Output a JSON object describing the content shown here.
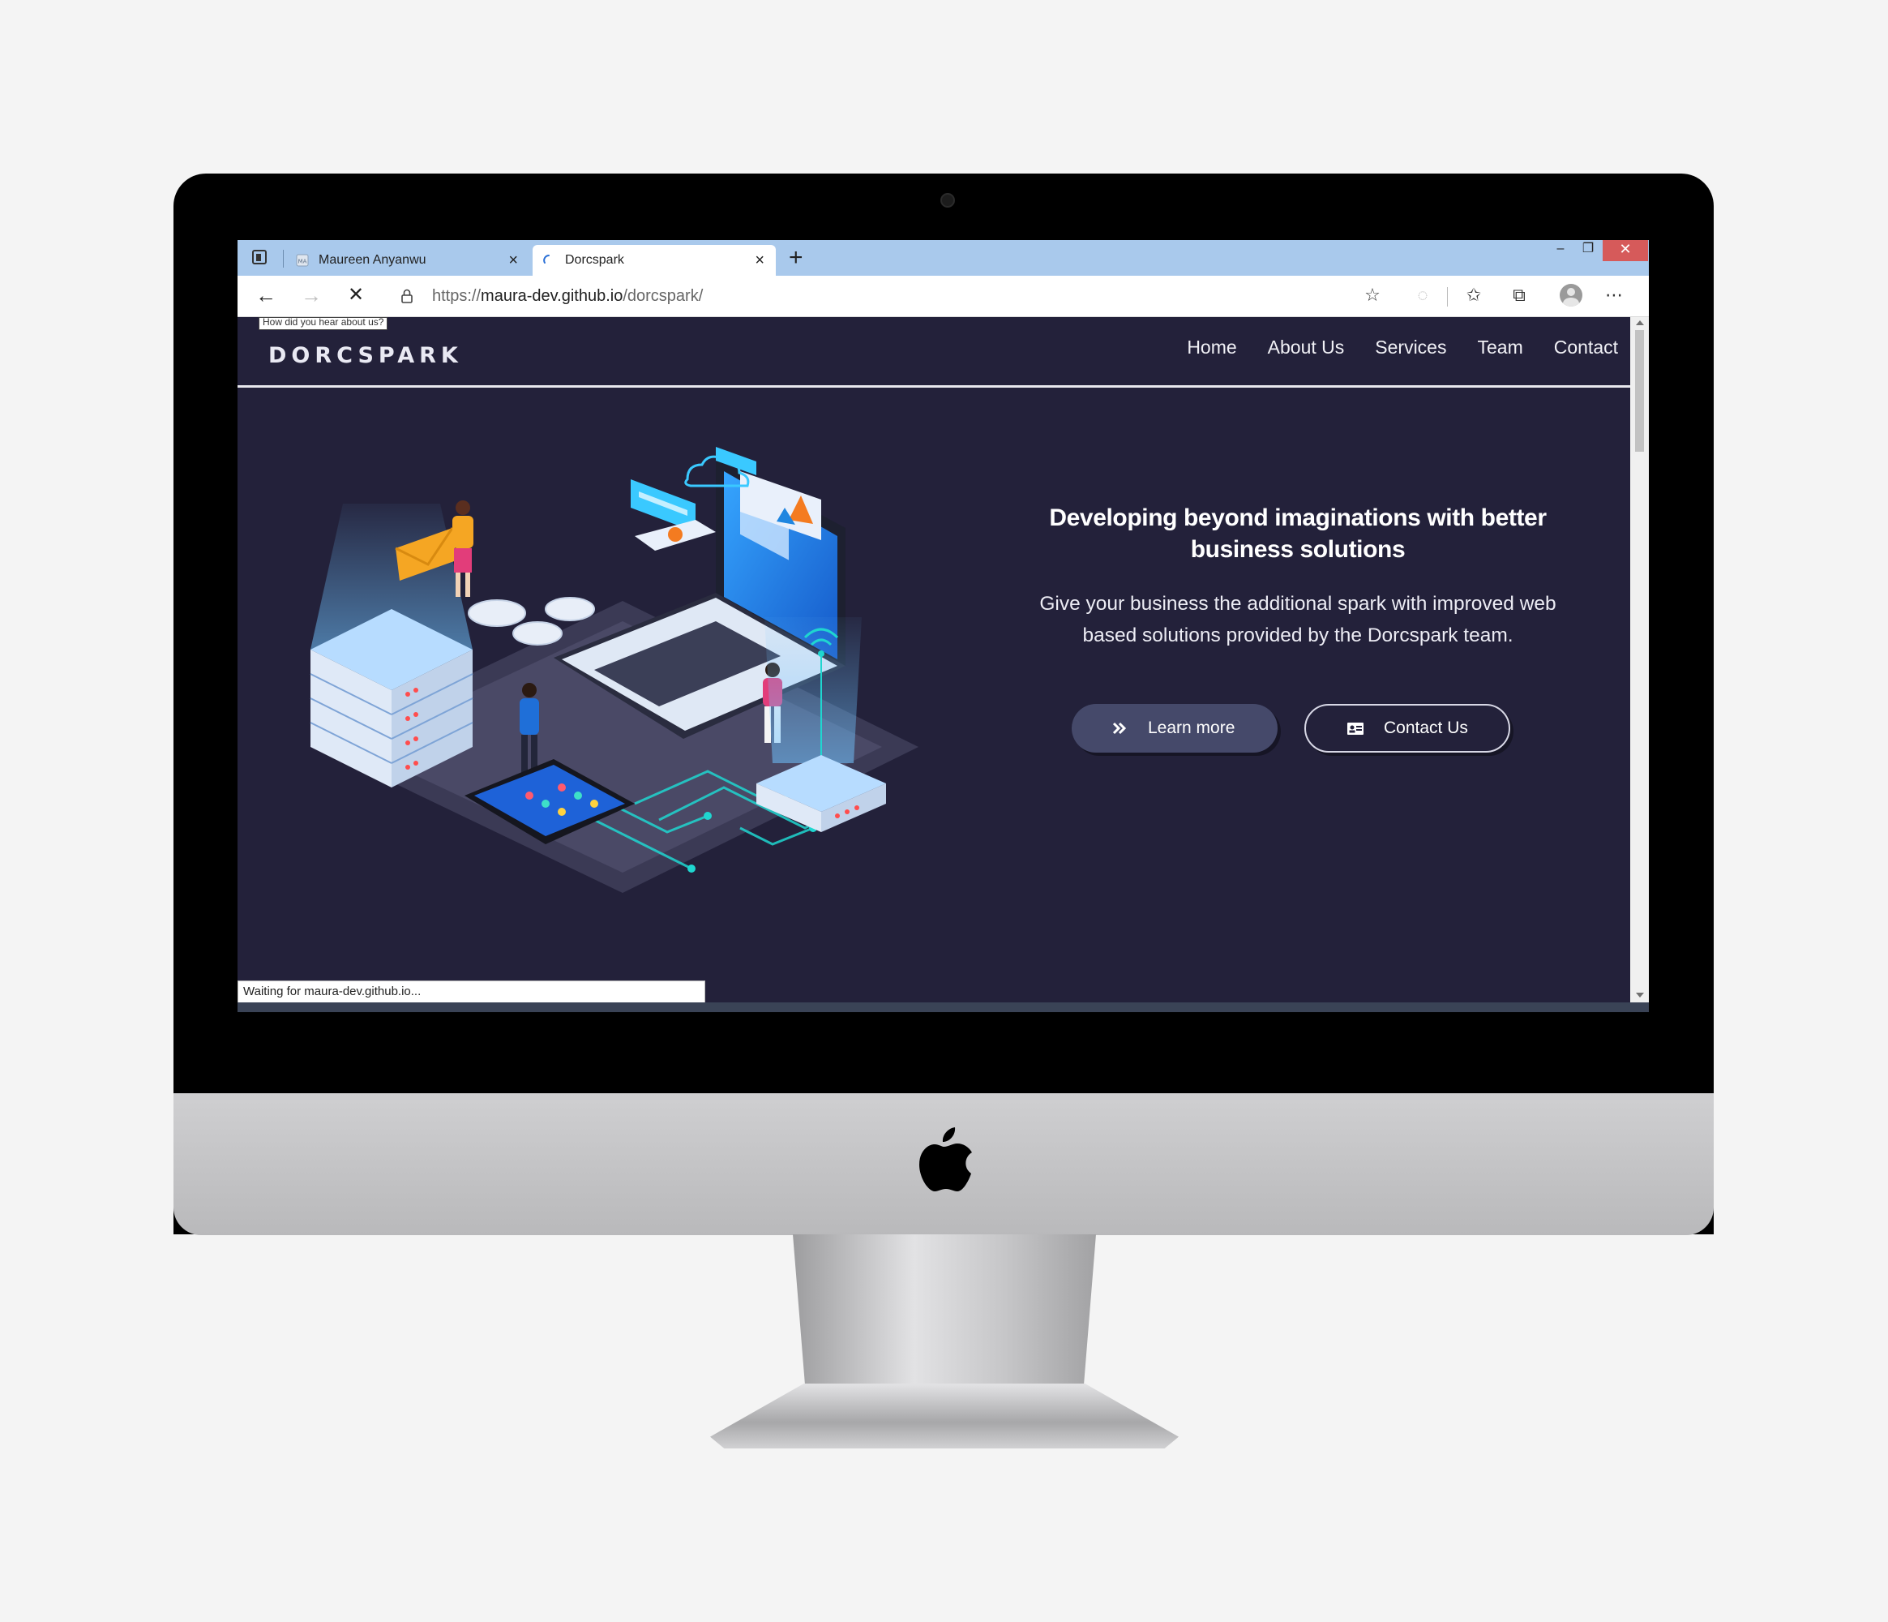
{
  "browser": {
    "tabs": [
      {
        "title": "Maureen Anyanwu",
        "active": false
      },
      {
        "title": "Dorcspark",
        "active": true
      }
    ],
    "url_prefix": "https://",
    "url_domain": "maura-dev.github.io",
    "url_path": "/dorcspark/",
    "status_text": "Waiting for maura-dev.github.io...",
    "tooltip_text": "How did you hear about us?",
    "window_controls": {
      "minimize": "–",
      "maximize": "❐",
      "close": "✕"
    }
  },
  "site": {
    "brand": "DORCSPARK",
    "nav": [
      "Home",
      "About Us",
      "Services",
      "Team",
      "Contact"
    ],
    "hero": {
      "heading": "Developing beyond imaginations with better business solutions",
      "subheading": "Give your business the additional spark with improved web based solutions provided by the Dorcspark team.",
      "learn_more_label": "Learn more",
      "contact_label": "Contact Us"
    }
  },
  "icons": {
    "tab_actions": "tab-actions-icon",
    "back": "arrow-left-icon",
    "forward": "arrow-right-icon",
    "stop": "close-icon",
    "lock": "lock-icon",
    "learn_more": "double-chevron-right-icon",
    "contact": "contact-card-icon"
  },
  "colors": {
    "page_background": "#23213a",
    "tab_bar": "#a9c9ec",
    "learn_button": "#45496a",
    "close_button": "#d65a5a"
  }
}
